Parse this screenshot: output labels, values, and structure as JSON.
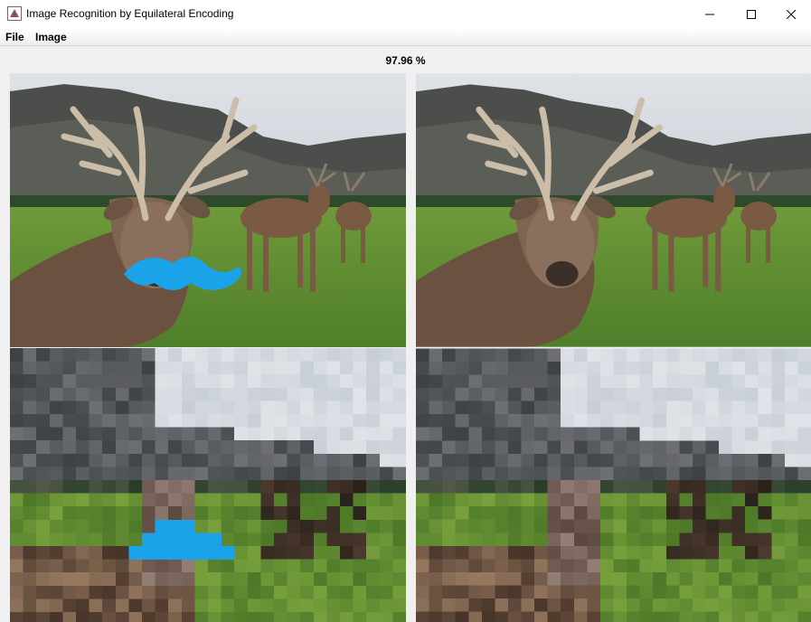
{
  "window": {
    "title": "Image Recognition by Equilateral Encoding",
    "icon": "java-app-icon",
    "controls": [
      "minimize-icon",
      "maximize-icon",
      "close-icon"
    ]
  },
  "menu": {
    "file": "File",
    "image": "Image"
  },
  "result": {
    "accuracy": "97.96",
    "unit": "%"
  },
  "panels": [
    {
      "name": "input-image",
      "content": "deer-photo-with-mustache"
    },
    {
      "name": "reference-image",
      "content": "deer-photo"
    },
    {
      "name": "input-pixelated",
      "content": "deer-pixelated-with-mustache"
    },
    {
      "name": "reference-pixelated",
      "content": "deer-pixelated"
    }
  ],
  "colors": {
    "mustache": "#1aa3e8",
    "sky": "#c9cfd6",
    "grass": "#5f8f33",
    "mountain": "#4a4d4a"
  }
}
